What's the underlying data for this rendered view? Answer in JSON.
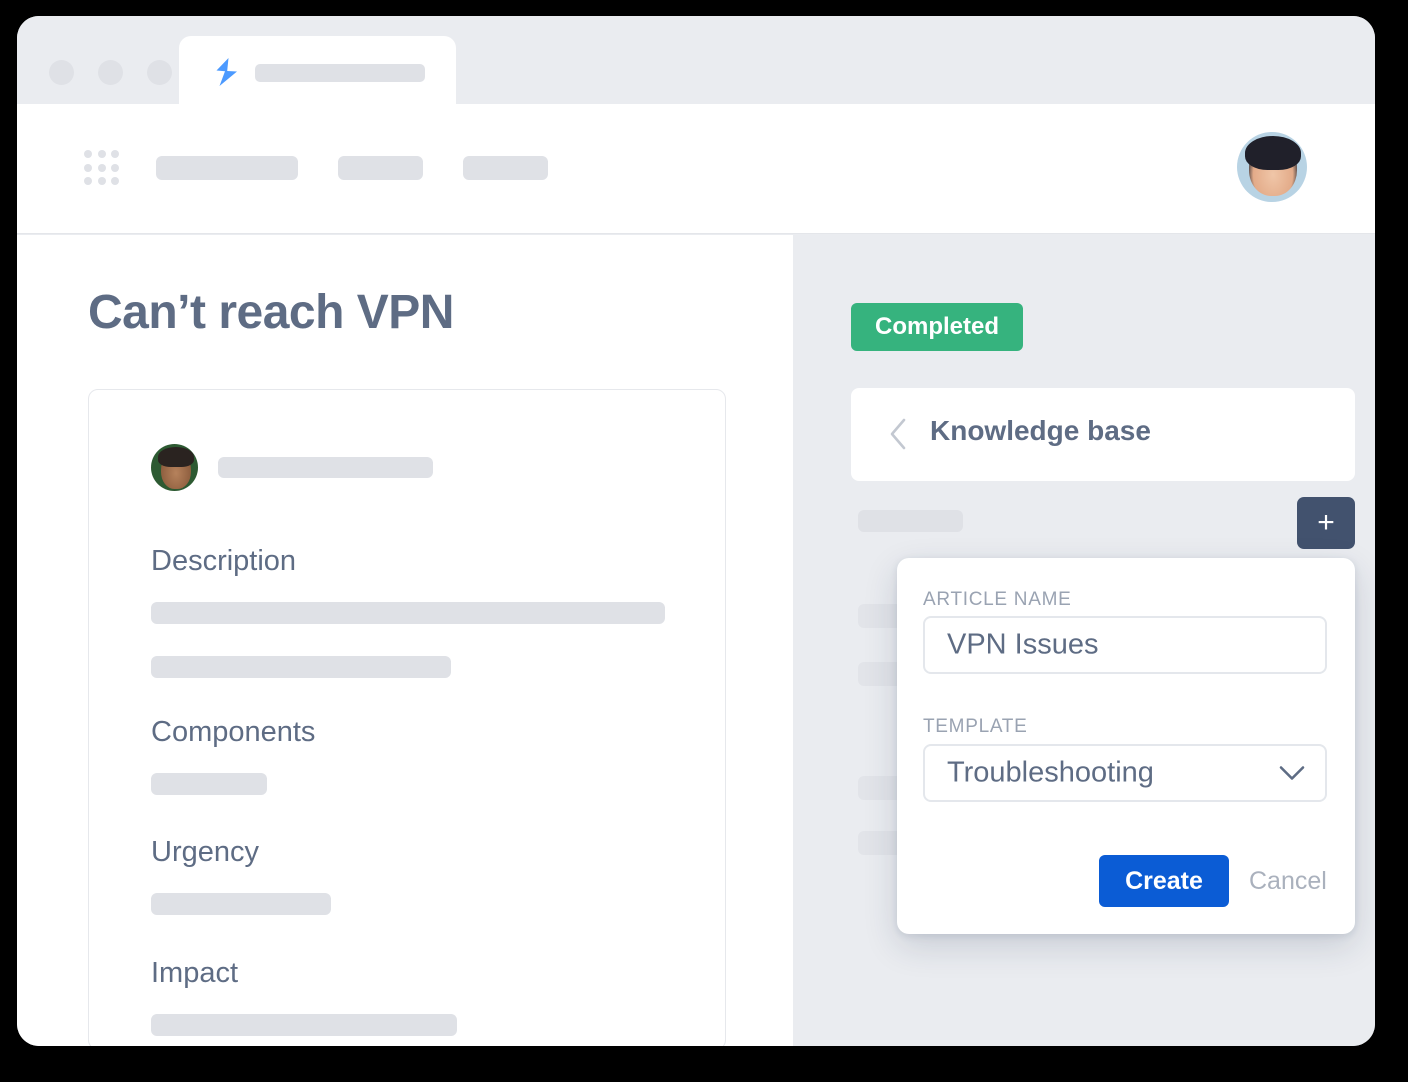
{
  "window": {
    "traffic_lights": [
      "close",
      "minimize",
      "maximize"
    ],
    "tab": {
      "favicon": "lightning-bolt-icon",
      "title_placeholder": ""
    }
  },
  "appbar": {
    "app_switcher_icon": "grid-dots-icon",
    "nav_placeholders": [
      "",
      "",
      ""
    ],
    "avatar": "user-avatar"
  },
  "issue": {
    "title": "Can’t reach VPN",
    "reporter_name_placeholder": "",
    "fields": [
      {
        "label": "Description",
        "values": [
          "",
          ""
        ]
      },
      {
        "label": "Components",
        "values": [
          ""
        ]
      },
      {
        "label": "Urgency",
        "values": [
          ""
        ]
      },
      {
        "label": "Impact",
        "values": [
          ""
        ]
      }
    ]
  },
  "right_panel": {
    "status_badge": "Completed",
    "back_icon": "chevron-left-icon",
    "knowledge_base_title": "Knowledge base",
    "add_button_icon": "plus-icon",
    "add_button_label": "+",
    "list_placeholders": [
      "",
      "",
      "",
      "",
      ""
    ]
  },
  "popover": {
    "article_name_label": "ARTICLE NAME",
    "article_name_value": "VPN Issues",
    "article_name_placeholder": "Article name",
    "template_label": "TEMPLATE",
    "template_value": "Troubleshooting",
    "template_options": [
      "Troubleshooting"
    ],
    "template_chevron_icon": "chevron-down-icon",
    "create_label": "Create",
    "cancel_label": "Cancel"
  },
  "colors": {
    "page_background": "#000000",
    "window_chrome": "#eaecf0",
    "panel_background": "#eaecf0",
    "text_slate": "#5e6c84",
    "status_green": "#36b37e",
    "primary_blue": "#0b5cd5",
    "dark_button": "#42526e",
    "placeholder_gray": "#dfe1e6",
    "favicon_blue": "#4c9aff"
  }
}
